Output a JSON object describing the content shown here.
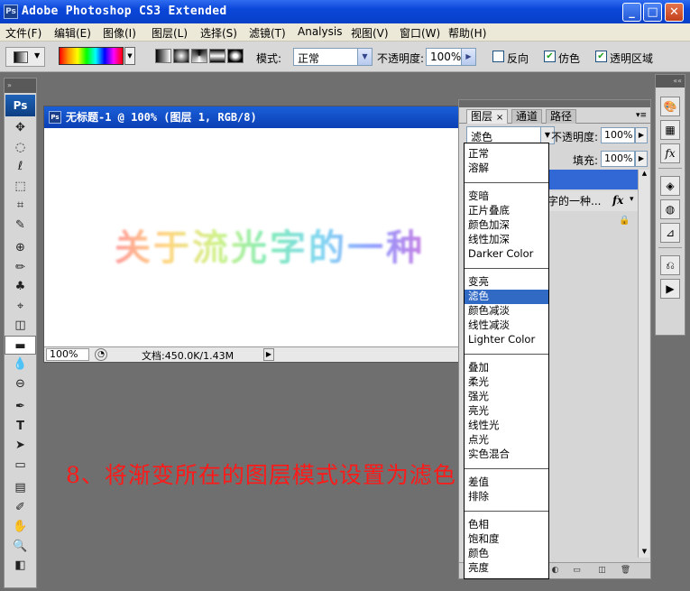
{
  "app": {
    "title": "Adobe Photoshop CS3 Extended",
    "icon_text": "Ps",
    "window_buttons": [
      "_",
      "□",
      "✕"
    ]
  },
  "menu": [
    "文件(F)",
    "编辑(E)",
    "图像(I)",
    "图层(L)",
    "选择(S)",
    "滤镜(T)",
    "Analysis",
    "视图(V)",
    "窗口(W)",
    "帮助(H)"
  ],
  "options": {
    "mode_label": "模式:",
    "mode_value": "正常",
    "opacity_label": "不透明度:",
    "opacity_value": "100%",
    "reverse_label": "反向",
    "dither_label": "仿色",
    "transparency_label": "透明区域",
    "reverse_checked": false,
    "dither_checked": true,
    "transparency_checked": true
  },
  "toolbox": {
    "header": "»",
    "logo": "Ps",
    "tools": [
      "✥",
      "◌",
      "ℓ",
      "⬚",
      "⌗",
      "✎",
      "⊕",
      "✏",
      "♣",
      "⌖",
      "◫",
      "▬",
      "💧",
      "⊖",
      "✒",
      "T",
      "➤",
      "▭",
      "▤",
      "✐",
      "✋",
      "🔍",
      "◧"
    ]
  },
  "document": {
    "title": "无标题-1 @ 100% (图层 1, RGB/8)",
    "icon_text": "Ps",
    "canvas_text": "关于流光字的一种",
    "zoom": "100%",
    "doc_info": "文档:450.0K/1.43M",
    "status_icon": "◔",
    "status_arrow": "▶"
  },
  "layers_panel": {
    "tabs": [
      "图层",
      "通道",
      "路径"
    ],
    "tab_close": "×",
    "menu_icon": "▾≡",
    "blend_value": "滤色",
    "opacity_label": "不透明度:",
    "opacity_value": "100%",
    "fill_label": "填充:",
    "fill_value": "100%",
    "layer_text": "字的一种...",
    "fx": "fx",
    "fx_arrow": "▾",
    "lock_char": "🔒",
    "bottom_icons": [
      "◐",
      "▭",
      "◫",
      "🗑"
    ],
    "scroll_up": "▲",
    "scroll_down": "▼",
    "arrow": "▶"
  },
  "blend_modes": {
    "selected": "滤色",
    "groups": [
      [
        "正常",
        "溶解"
      ],
      [
        "变暗",
        "正片叠底",
        "颜色加深",
        "线性加深",
        "Darker Color"
      ],
      [
        "变亮",
        "滤色",
        "颜色减淡",
        "线性减淡",
        "Lighter Color"
      ],
      [
        "叠加",
        "柔光",
        "强光",
        "亮光",
        "线性光",
        "点光",
        "实色混合"
      ],
      [
        "差值",
        "排除"
      ],
      [
        "色相",
        "饱和度",
        "颜色",
        "亮度"
      ]
    ]
  },
  "dock": {
    "header": "««",
    "icons": [
      "🎨",
      "▦",
      "fx",
      "◈",
      "◍",
      "⊿",
      "⎌",
      "▶"
    ]
  },
  "caption": "8、将渐变所在的图层模式设置为滤色",
  "colors": {
    "titlebar": "#0a46d8",
    "selection": "#316ac5",
    "caption": "#ff1a1a",
    "workspace": "#6f6f6f"
  }
}
